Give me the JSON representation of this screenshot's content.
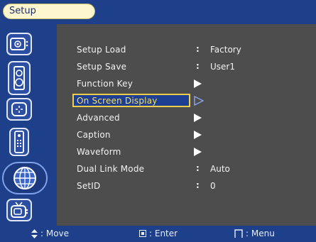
{
  "header": {
    "title": "Setup"
  },
  "sidebar": {
    "icons": [
      "picture-icon",
      "audio-icon",
      "setup-icon",
      "remote-icon",
      "globe-icon",
      "tv-icon"
    ],
    "active_index": 4
  },
  "menu": {
    "rows": [
      {
        "label": "Setup Load",
        "kind": "value",
        "value": "Factory"
      },
      {
        "label": "Setup Save",
        "kind": "value",
        "value": "User1"
      },
      {
        "label": "Function Key",
        "kind": "submenu"
      },
      {
        "label": "On Screen Display",
        "kind": "submenu",
        "selected": true
      },
      {
        "label": "Advanced",
        "kind": "submenu"
      },
      {
        "label": "Caption",
        "kind": "submenu"
      },
      {
        "label": "Waveform",
        "kind": "submenu"
      },
      {
        "label": "Dual Link Mode",
        "kind": "value",
        "value": "Auto"
      },
      {
        "label": "SetID",
        "kind": "value",
        "value": "0"
      }
    ],
    "colon": ":"
  },
  "status": {
    "move_label": ": Move",
    "enter_label": ": Enter",
    "menu_label": ": Menu"
  },
  "colors": {
    "accent_blue": "#1e3f8a",
    "panel_gray": "#4d4d4d",
    "highlight_text": "#f7e05a",
    "highlight_border": "#f0d04a"
  }
}
